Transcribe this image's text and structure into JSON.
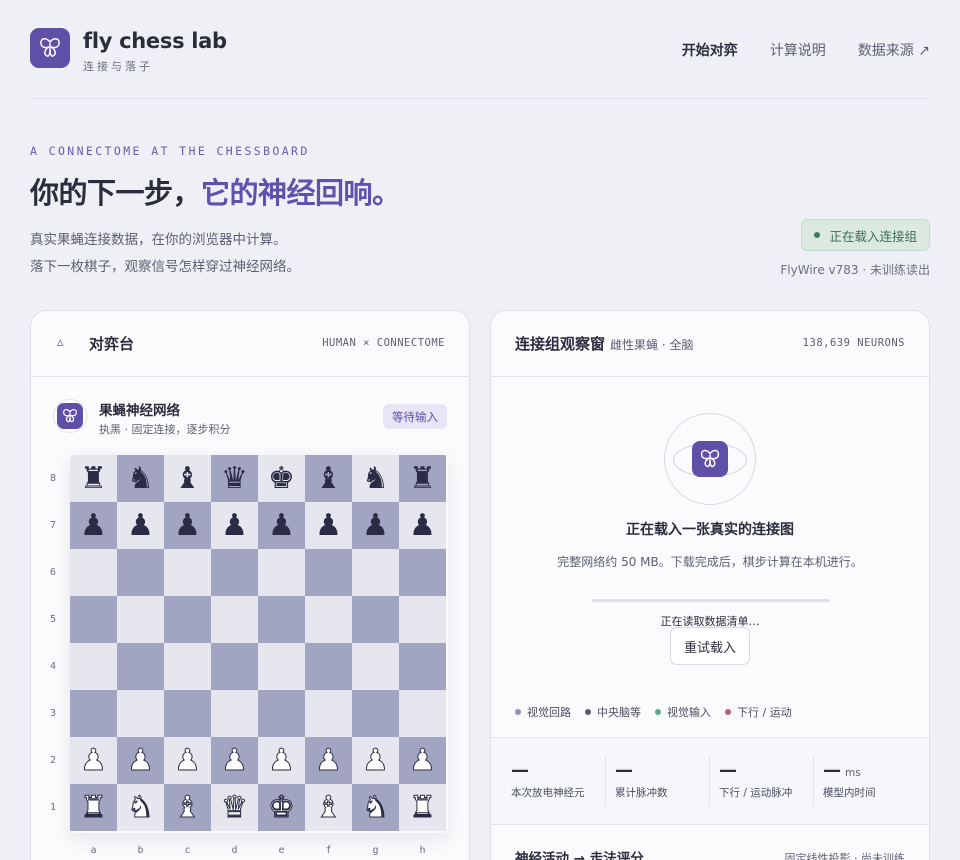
{
  "brand": {
    "name": "fly chess lab",
    "subtitle": "连接与落子",
    "logo_icon": "butterfly-icon"
  },
  "nav": [
    {
      "label": "开始对弈",
      "active": true
    },
    {
      "label": "计算说明",
      "active": false
    },
    {
      "label": "数据来源 ↗",
      "active": false
    }
  ],
  "hero": {
    "eyebrow": "A CONNECTOME AT THE CHESSBOARD",
    "title_main": "你的下一步，",
    "title_accent": "它的神经回响。",
    "desc_line1": "真实果蝇连接数据，在你的浏览器中计算。",
    "desc_line2": "落下一枚棋子，观察信号怎样穿过神经网络。",
    "status": "正在载入连接组",
    "status_sub": "FlyWire v783 · 未训练读出"
  },
  "game_panel": {
    "icon": "triangle-icon",
    "title": "对弈台",
    "tag": "HUMAN × CONNECTOME",
    "opponent_name": "果蝇神经网络",
    "opponent_desc": "执黑 · 固定连接，逐步积分",
    "opponent_status": "等待输入",
    "ranks": [
      "8",
      "7",
      "6",
      "5",
      "4",
      "3",
      "2",
      "1"
    ],
    "files": [
      "a",
      "b",
      "c",
      "d",
      "e",
      "f",
      "g",
      "h"
    ],
    "board": [
      [
        "bR",
        "bN",
        "bB",
        "bQ",
        "bK",
        "bB",
        "bN",
        "bR"
      ],
      [
        "bP",
        "bP",
        "bP",
        "bP",
        "bP",
        "bP",
        "bP",
        "bP"
      ],
      [
        "",
        "",
        "",
        "",
        "",
        "",
        "",
        ""
      ],
      [
        "",
        "",
        "",
        "",
        "",
        "",
        "",
        ""
      ],
      [
        "",
        "",
        "",
        "",
        "",
        "",
        "",
        ""
      ],
      [
        "",
        "",
        "",
        "",
        "",
        "",
        "",
        ""
      ],
      [
        "wP",
        "wP",
        "wP",
        "wP",
        "wP",
        "wP",
        "wP",
        "wP"
      ],
      [
        "wR",
        "wN",
        "wB",
        "wQ",
        "wK",
        "wB",
        "wN",
        "wR"
      ]
    ],
    "colors": {
      "light_square": "#e6e7ee",
      "dark_square": "#a2a5c2",
      "piece_dark": "#2a2b45"
    }
  },
  "connectome_panel": {
    "title": "连接组观察窗",
    "subtitle": "雌性果蝇 · 全脑",
    "neuron_count": "138,639 NEURONS",
    "load_title": "正在载入一张真实的连接图",
    "load_desc": "完整网络约 50 MB。下载完成后，棋步计算在本机进行。",
    "progress_text": "正在读取数据清单…",
    "progress_fraction": 0.0,
    "retry_label": "重试载入",
    "legend": [
      {
        "label": "视觉回路",
        "color": "#8b92b8"
      },
      {
        "label": "中央脑等",
        "color": "#5a5d75"
      },
      {
        "label": "视觉输入",
        "color": "#5ba88a"
      },
      {
        "label": "下行 / 运动",
        "color": "#b5616a"
      }
    ],
    "stats": [
      {
        "value": "—",
        "unit": "",
        "label": "本次放电神经元"
      },
      {
        "value": "—",
        "unit": "",
        "label": "累计脉冲数"
      },
      {
        "value": "—",
        "unit": "",
        "label": "下行 / 运动脉冲"
      },
      {
        "value": "—",
        "unit": "ms",
        "label": "模型内时间"
      }
    ],
    "score_title": "神经活动 → 走法评分",
    "score_tag": "固定线性投影 · 尚未训练"
  }
}
